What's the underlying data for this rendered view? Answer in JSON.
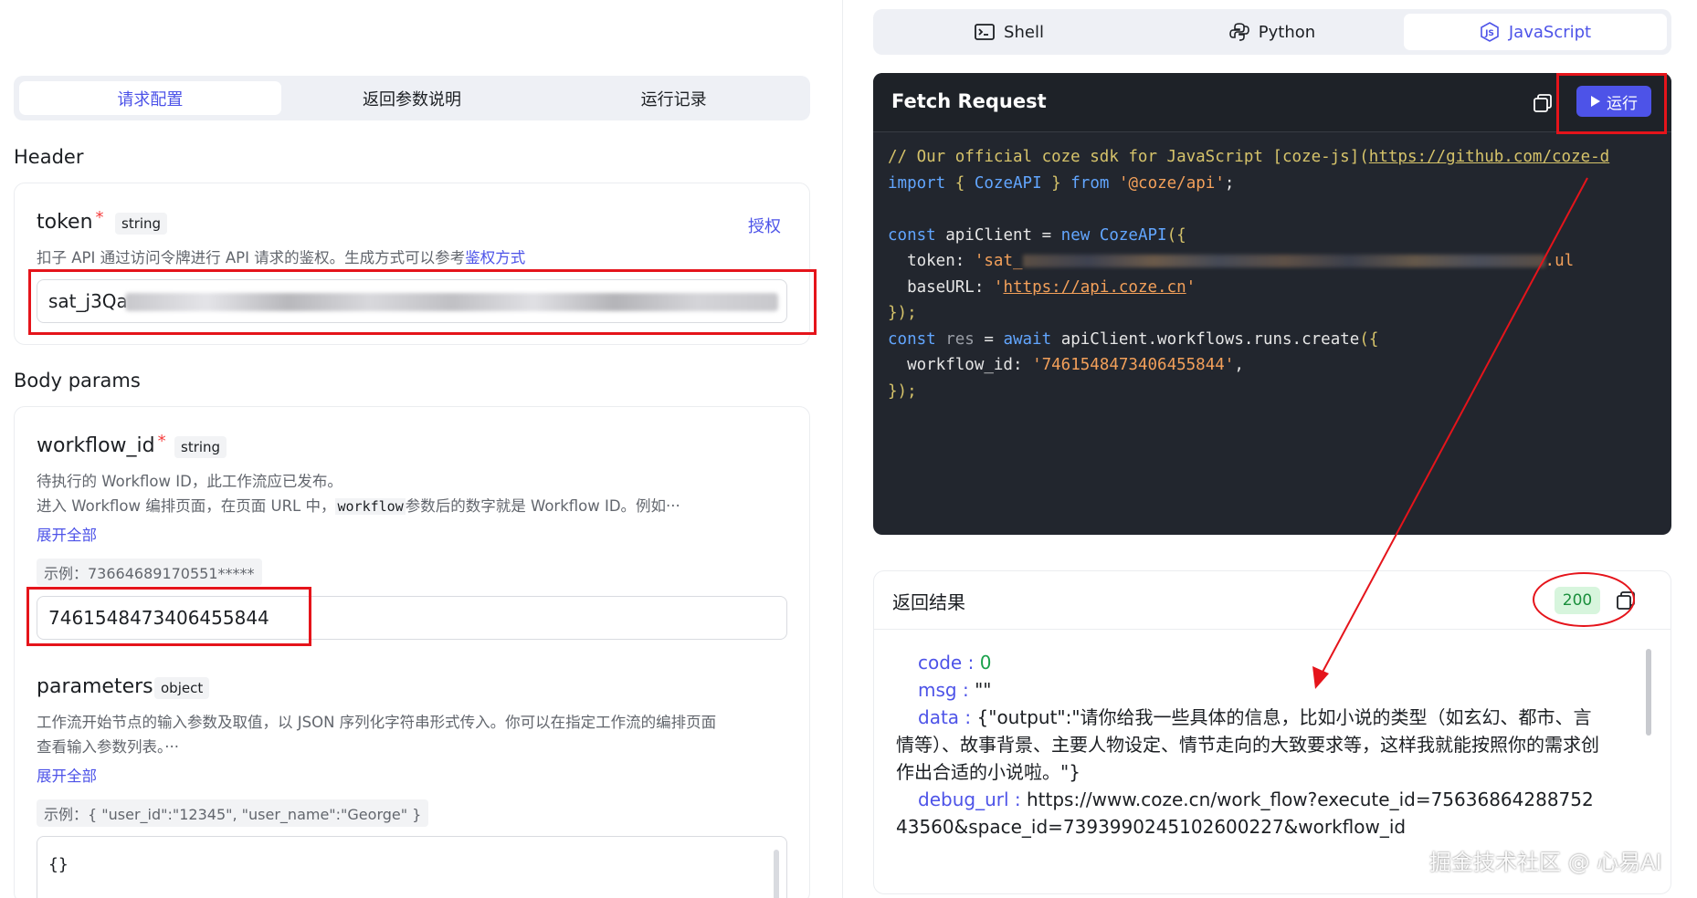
{
  "left": {
    "tabs": [
      "请求配置",
      "返回参数说明",
      "运行记录"
    ],
    "header_section": "Header",
    "token": {
      "name": "token",
      "required_mark": "*",
      "type": "string",
      "auth_link": "授权",
      "desc_prefix": "扣子 API 通过访问令牌进行 API 请求的鉴权。生成方式可以参考",
      "desc_link": "鉴权方式",
      "value": "sat_j3Qa"
    },
    "body_section": "Body params",
    "workflow_id": {
      "name": "workflow_id",
      "required_mark": "*",
      "type": "string",
      "desc_line1": "待执行的 Workflow ID，此工作流应已发布。",
      "desc_line2_prefix": "进入 Workflow 编排页面，在页面 URL 中，",
      "desc_line2_code": "workflow",
      "desc_line2_suffix": "参数后的数字就是 Workflow ID。例如···",
      "expand": "展开全部",
      "example": "示例：73664689170551*****",
      "value": "7461548473406455844"
    },
    "parameters": {
      "name": "parameters",
      "type": "object",
      "desc_line1": "工作流开始节点的输入参数及取值，以 JSON 序列化字符串形式传入。你可以在指定工作流的编排页面",
      "desc_line2": "查看输入参数列表。···",
      "expand": "展开全部",
      "example": "示例：{ \"user_id\":\"12345\", \"user_name\":\"George\" }",
      "value": "{}"
    }
  },
  "right": {
    "lang_tabs": [
      {
        "label": "Shell",
        "icon": "terminal-icon"
      },
      {
        "label": "Python",
        "icon": "python-icon"
      },
      {
        "label": "JavaScript",
        "icon": "javascript-icon"
      }
    ],
    "code_title": "Fetch Request",
    "run_label": "运行",
    "code": {
      "comment": "// Our official coze sdk for JavaScript [coze-js](",
      "comment_url": "https://github.com/coze-d",
      "import_kw": "import",
      "import_name": "CozeAPI",
      "from_kw": "from",
      "import_src": "'@coze/api'",
      "const_kw": "const",
      "client_var": "apiClient",
      "new_kw": "new",
      "class_name": "CozeAPI",
      "token_key": "token:",
      "token_val": "'sat_",
      "token_tail": ".ul",
      "baseurl_key": "baseURL:",
      "baseurl_val": "https://api.coze.cn",
      "res_var": "res",
      "await_kw": "await",
      "call": "apiClient.workflows.runs.create",
      "wf_key": "workflow_id:",
      "wf_val": "'7461548473406455844'"
    },
    "result": {
      "title": "返回结果",
      "status": "200",
      "code_key": "code",
      "code_val": "0",
      "msg_key": "msg",
      "msg_val": "\"\"",
      "data_key": "data",
      "data_val": "{\"output\":\"请你给我一些具体的信息，比如小说的类型（如玄幻、都市、言情等）、故事背景、主要人物设定、情节走向的大致要求等，这样我就能按照你的需求创作出合适的小说啦。\"}",
      "debug_key": "debug_url",
      "debug_val": "https://www.coze.cn/work_flow?execute_id=7563686428875243560&space_id=7393990245102600227&workflow_id"
    },
    "watermark": "掘金技术社区 @ 心易AI"
  }
}
